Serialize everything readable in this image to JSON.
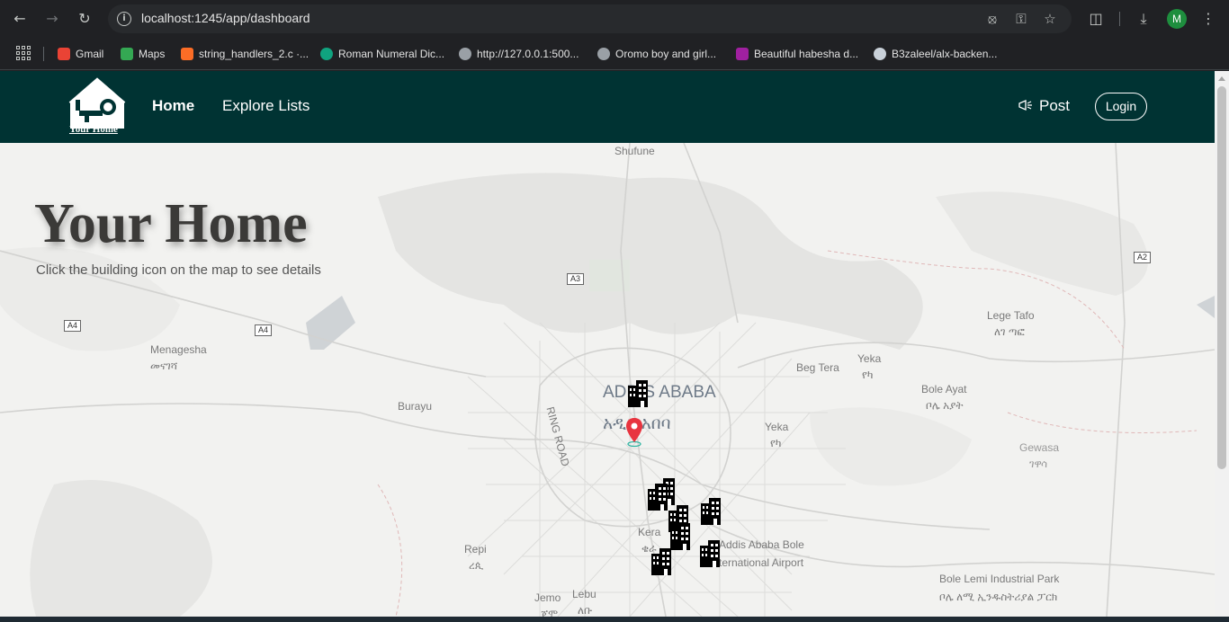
{
  "browser": {
    "url": "localhost:1245/app/dashboard",
    "profile_initial": "M",
    "bookmarks": [
      {
        "label": "Gmail",
        "color": "#ea4335"
      },
      {
        "label": "Maps",
        "color": "#34a853"
      },
      {
        "label": "string_handlers_2.c ·...",
        "color": "#fc6d26"
      },
      {
        "label": "Roman Numeral Dic...",
        "color": "#10a37f"
      },
      {
        "label": "http://127.0.0.1:500...",
        "color": "#9aa0a6"
      },
      {
        "label": "Oromo boy and girl...",
        "color": "#9aa0a6"
      },
      {
        "label": "Beautiful habesha d...",
        "color": "#a020a0"
      },
      {
        "label": "B3zaleel/alx-backen...",
        "color": "#c9d1d9"
      }
    ]
  },
  "site": {
    "logo_text": "Your Home",
    "nav": {
      "home": "Home",
      "explore": "Explore Lists",
      "post": "Post",
      "login": "Login"
    },
    "hero": {
      "title": "Your Home",
      "subtitle": "Click the building icon on the map to see details"
    }
  },
  "map": {
    "labels": {
      "shufune": "Shufune",
      "menagesha": "Menagesha",
      "menagesha_am": "መናገሻ",
      "burayu": "Burayu",
      "ring_road": "RING ROAD",
      "beg_tera": "Beg Tera",
      "yeka1": "Yeka",
      "yeka1_am": "የካ",
      "yeka2": "Yeka",
      "yeka2_am": "የካ",
      "lege_tafo": "Lege Tafo",
      "lege_tafo_am": "ለገ ጣፎ",
      "bole_ayat": "Bole Ayat",
      "bole_ayat_am": "ቦሌ አያት",
      "gewasa": "Gewasa",
      "gewasa_am": "ገዋሳ",
      "kera": "Kera",
      "kera_am": "ቄራ",
      "repi": "Repi",
      "repi_am": "ረጲ",
      "jemo": "Jemo",
      "jemo_am": "ጀሞ",
      "lebu": "Lebu",
      "lebu_am": "ለቡ",
      "airport1": "Addis Ababa Bole",
      "airport2": "International Airport",
      "industrial": "Bole Lemi Industrial Park",
      "industrial_am": "ቦሌ ለሚ ኢንዱስትሪያል ፓርክ"
    },
    "city_name": "ADDIS ABABA",
    "city_name_am": "አዲስ አበባ",
    "roads": {
      "a3": "A3",
      "a4a": "A4",
      "a4b": "A4",
      "a2": "A2"
    },
    "pin_color": "#e8343f",
    "marker_icon": "building-icon"
  },
  "colors": {
    "nav_bg": "#003333",
    "map_bg": "#f2f2f0"
  }
}
